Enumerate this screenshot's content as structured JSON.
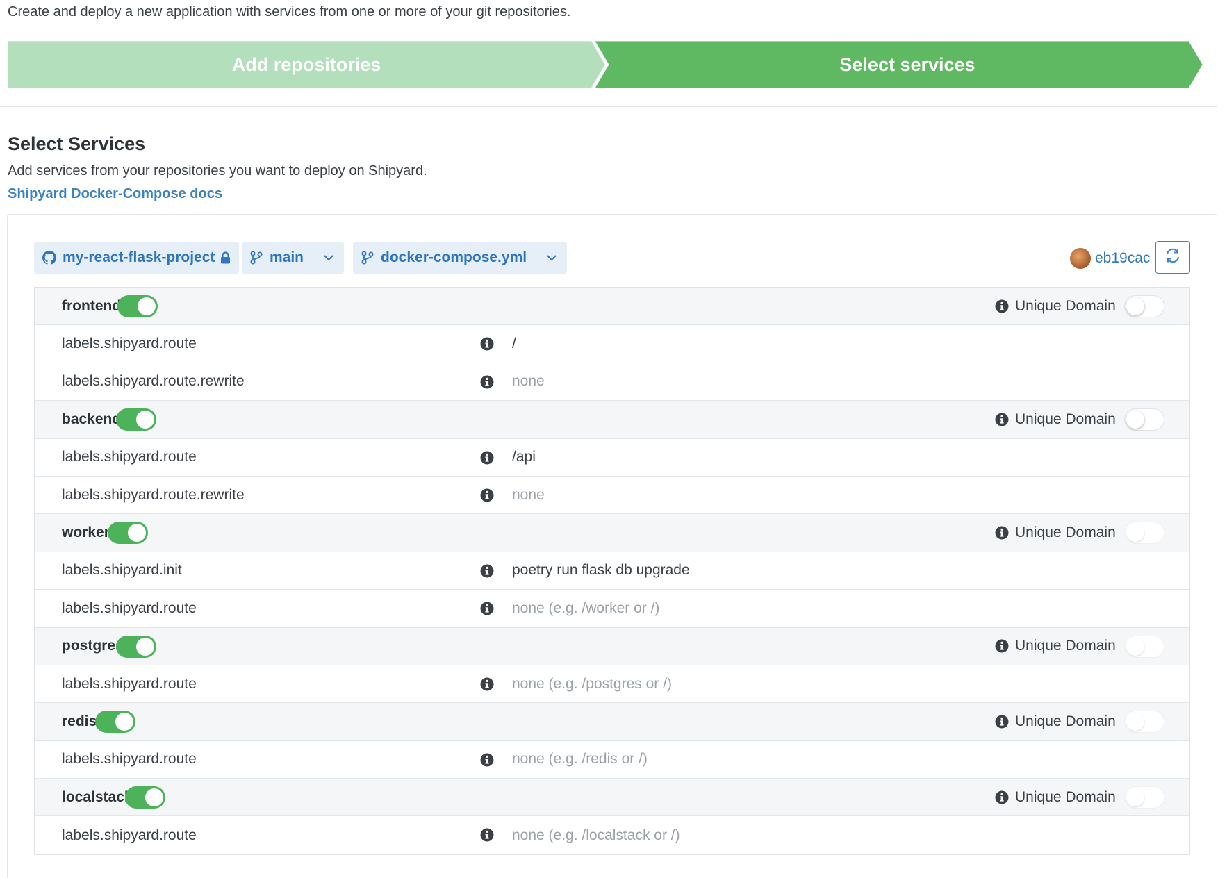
{
  "intro": "Create and deploy a new application with services from one or more of your git repositories.",
  "steps": [
    {
      "label": "Add repositories",
      "color": "#b3dfbd"
    },
    {
      "label": "Select services",
      "color": "#5fb862"
    }
  ],
  "section": {
    "title": "Select Services",
    "subtitle": "Add services from your repositories you want to deploy on Shipyard.",
    "docs_link": "Shipyard Docker-Compose docs"
  },
  "toolbar": {
    "repo": "my-react-flask-project",
    "branch": "main",
    "compose_file": "docker-compose.yml",
    "user": "eb19cac",
    "icons": {
      "repo": "github-icon",
      "lock": "lock-icon",
      "branch": "git-branch-icon",
      "dropdown": "chevron-down-icon",
      "refresh": "refresh-icon"
    }
  },
  "unique_domain_label": "Unique Domain",
  "services": [
    {
      "name": "frontend",
      "enabled": true,
      "unique_domain": false,
      "labels": [
        {
          "key": "labels.shipyard.route",
          "value": "/",
          "placeholder": false
        },
        {
          "key": "labels.shipyard.route.rewrite",
          "value": "none",
          "placeholder": true
        }
      ]
    },
    {
      "name": "backend",
      "enabled": true,
      "unique_domain": false,
      "labels": [
        {
          "key": "labels.shipyard.route",
          "value": "/api",
          "placeholder": false
        },
        {
          "key": "labels.shipyard.route.rewrite",
          "value": "none",
          "placeholder": true
        }
      ]
    },
    {
      "name": "worker",
      "enabled": true,
      "unique_domain": false,
      "labels": [
        {
          "key": "labels.shipyard.init",
          "value": "poetry run flask db upgrade",
          "placeholder": false
        },
        {
          "key": "labels.shipyard.route",
          "value": "none (e.g. /worker or /)",
          "placeholder": true
        }
      ]
    },
    {
      "name": "postgres",
      "enabled": true,
      "unique_domain": false,
      "labels": [
        {
          "key": "labels.shipyard.route",
          "value": "none (e.g. /postgres or /)",
          "placeholder": true
        }
      ]
    },
    {
      "name": "redis",
      "enabled": true,
      "unique_domain": false,
      "labels": [
        {
          "key": "labels.shipyard.route",
          "value": "none (e.g. /redis or /)",
          "placeholder": true
        }
      ]
    },
    {
      "name": "localstack",
      "enabled": true,
      "unique_domain": false,
      "labels": [
        {
          "key": "labels.shipyard.route",
          "value": "none (e.g. /localstack or /)",
          "placeholder": true
        }
      ]
    }
  ]
}
